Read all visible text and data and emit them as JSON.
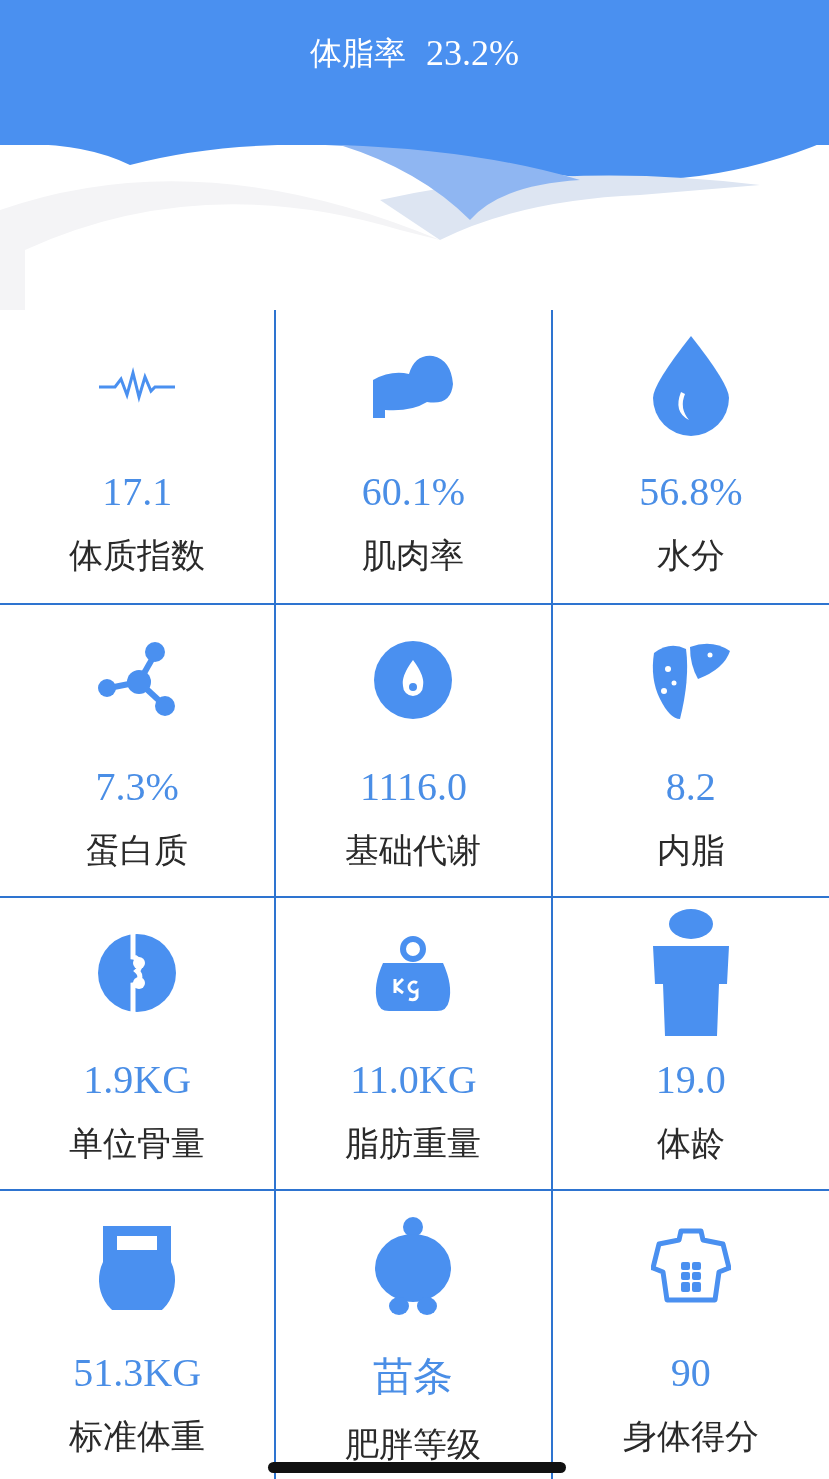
{
  "header": {
    "title": "体脂率",
    "value": "23.2%"
  },
  "metrics": [
    {
      "kind": "pulse",
      "value": "17.1",
      "label": "体质指数"
    },
    {
      "kind": "muscle",
      "value": "60.1%",
      "label": "肌肉率"
    },
    {
      "kind": "drop",
      "value": "56.8%",
      "label": "水分"
    },
    {
      "kind": "molecule",
      "value": "7.3%",
      "label": "蛋白质"
    },
    {
      "kind": "flame",
      "value": "1116.0",
      "label": "基础代谢"
    },
    {
      "kind": "liver",
      "value": "8.2",
      "label": "内脂"
    },
    {
      "kind": "bone",
      "value": "1.9KG",
      "label": "单位骨量"
    },
    {
      "kind": "kg",
      "value": "11.0KG",
      "label": "脂肪重量"
    },
    {
      "kind": "body",
      "value": "19.0",
      "label": "体龄"
    },
    {
      "kind": "kettlebell",
      "value": "51.3KG",
      "label": "标准体重"
    },
    {
      "kind": "figure",
      "value": "苗条",
      "label": "肥胖等级"
    },
    {
      "kind": "torso",
      "value": "90",
      "label": "身体得分"
    }
  ]
}
